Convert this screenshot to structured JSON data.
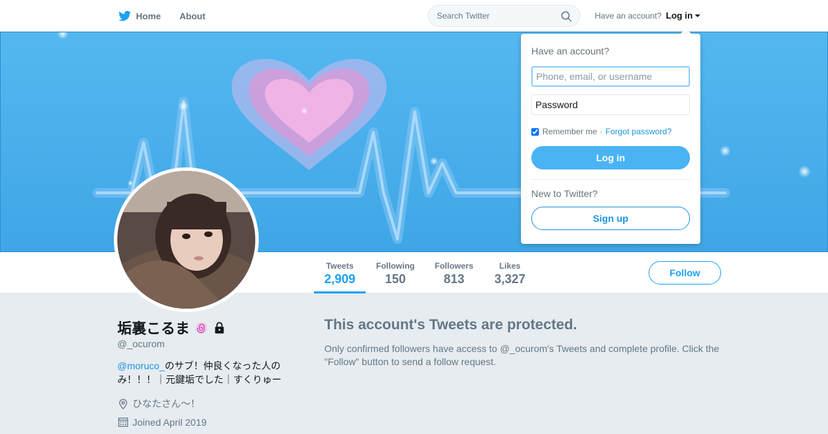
{
  "nav": {
    "home_label": "Home",
    "about_label": "About",
    "search_placeholder": "Search Twitter",
    "account_prompt": "Have an account?",
    "login_label": "Log in"
  },
  "profile": {
    "name": "垢裏こるま",
    "handle": "@_ocurom",
    "bio_mention": "@moruco_",
    "bio_text": "のサブ！仲良くなった人のみ！！！｜元鍵垢でした｜すくりゅー",
    "location": "ひなたさん〜！",
    "joined": "Joined April 2019"
  },
  "stats": [
    {
      "label": "Tweets",
      "value": "2,909"
    },
    {
      "label": "Following",
      "value": "150"
    },
    {
      "label": "Followers",
      "value": "813"
    },
    {
      "label": "Likes",
      "value": "3,327"
    }
  ],
  "follow_label": "Follow",
  "protected": {
    "title": "This account's Tweets are protected.",
    "text": "Only confirmed followers have access to @_ocurom's Tweets and complete profile. Click the \"Follow\" button to send a follow request."
  },
  "login_dropdown": {
    "heading": "Have an account?",
    "username_placeholder": "Phone, email, or username",
    "password_placeholder": "Password",
    "remember_label": "Remember me",
    "separator": "·",
    "forgot_label": "Forgot password?",
    "login_button": "Log in",
    "new_prompt": "New to Twitter?",
    "signup_button": "Sign up"
  },
  "colors": {
    "accent": "#1da1f2",
    "banner": "#47abeb"
  }
}
